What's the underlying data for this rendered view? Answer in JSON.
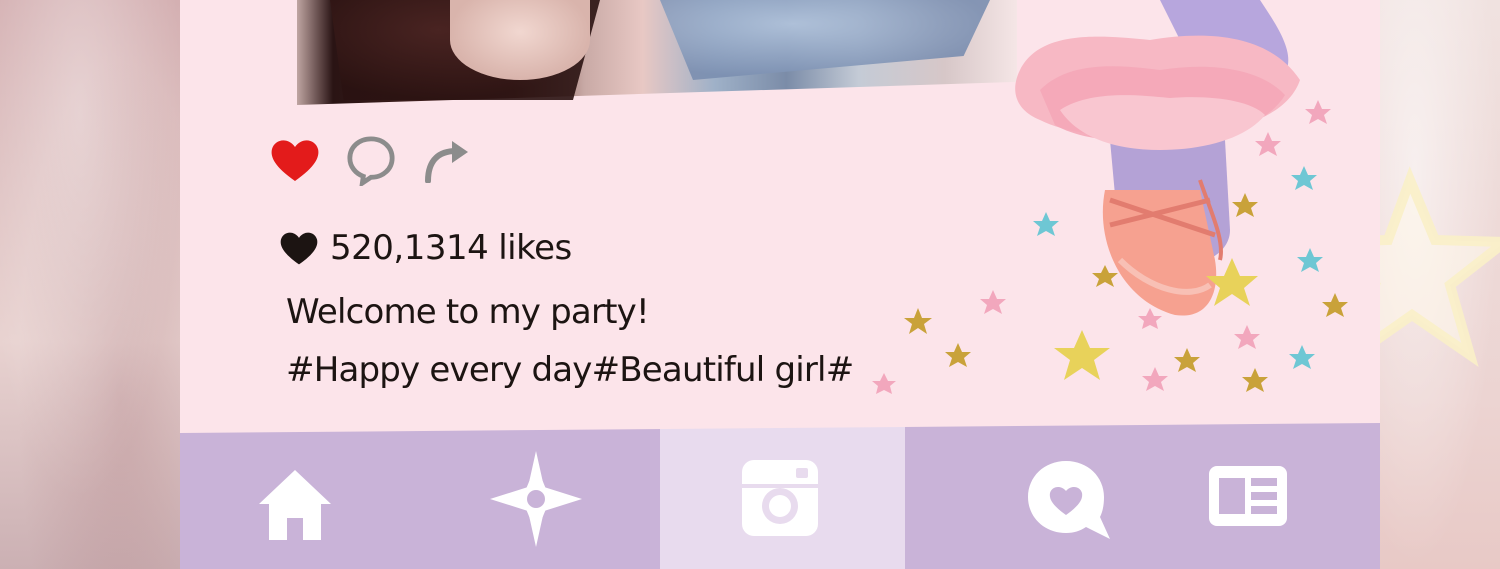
{
  "post": {
    "likes_count": "520,1314",
    "likes_label": "likes",
    "caption_line1": "Welcome to my party!",
    "caption_line2": "#Happy every day#Beautiful girl#"
  },
  "actions": [
    {
      "name": "heart-icon",
      "color": "#e31b1b"
    },
    {
      "name": "comment-icon",
      "color": "#8c8c8c"
    },
    {
      "name": "share-icon",
      "color": "#8c8c8c"
    }
  ],
  "nav": [
    {
      "name": "home-icon"
    },
    {
      "name": "explore-star-icon"
    },
    {
      "name": "camera-icon"
    },
    {
      "name": "heart-chat-icon"
    },
    {
      "name": "news-icon"
    }
  ],
  "colors": {
    "board": "#fce4ea",
    "nav": "#c9b3d8",
    "nav_active": "#e8dbee",
    "text": "#1c1412"
  }
}
